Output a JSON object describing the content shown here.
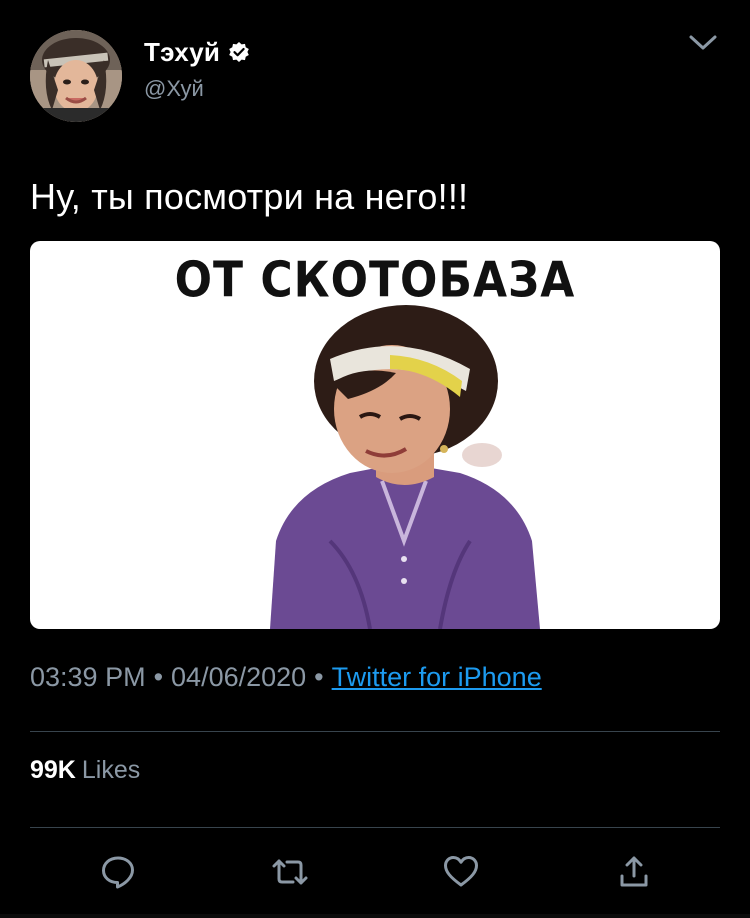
{
  "tweet": {
    "display_name": "Тэхуй",
    "handle": "@Хуй",
    "verified": true,
    "text": "Ну, ты посмотри на него!!!",
    "media": {
      "caption": "ОТ СКОТОБАЗА"
    },
    "time": "03:39 PM",
    "separator": "•",
    "date": "04/06/2020",
    "source": "Twitter for iPhone",
    "likes_count": "99K",
    "likes_label": "Likes"
  },
  "icons": {
    "menu": "chevron-down-icon",
    "verified": "verified-badge-icon",
    "reply": "reply-icon",
    "retweet": "retweet-icon",
    "like": "heart-icon",
    "share": "share-icon"
  },
  "colors": {
    "background": "#000000",
    "text": "#ffffff",
    "secondary": "#8b98a5",
    "link": "#1d9bf0",
    "divider": "#38444d"
  }
}
